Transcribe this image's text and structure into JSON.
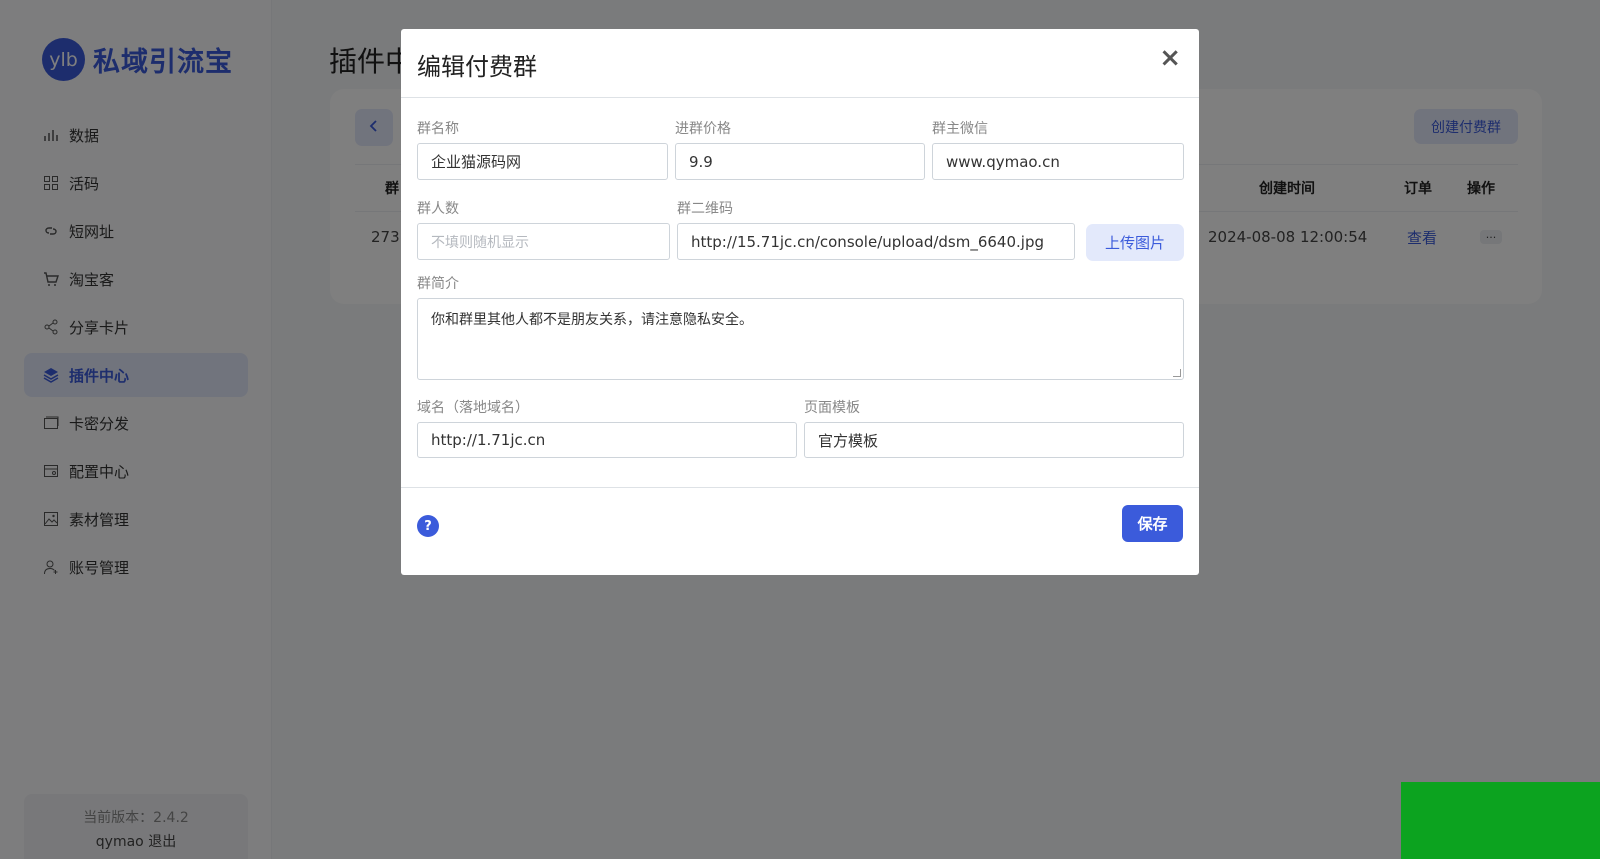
{
  "app": {
    "logo_mark": "ylb",
    "logo_text": "私域引流宝"
  },
  "sidebar": {
    "items": [
      {
        "label": "数据",
        "icon": "bar-chart-icon"
      },
      {
        "label": "活码",
        "icon": "grid-icon"
      },
      {
        "label": "短网址",
        "icon": "link-icon"
      },
      {
        "label": "淘宝客",
        "icon": "cart-icon"
      },
      {
        "label": "分享卡片",
        "icon": "share-icon"
      },
      {
        "label": "插件中心",
        "icon": "layers-icon",
        "active": true
      },
      {
        "label": "卡密分发",
        "icon": "card-icon"
      },
      {
        "label": "配置中心",
        "icon": "settings-icon"
      },
      {
        "label": "素材管理",
        "icon": "image-icon"
      },
      {
        "label": "账号管理",
        "icon": "user-icon"
      }
    ],
    "version": "当前版本：2.4.2",
    "username": "qymao",
    "logout": "退出"
  },
  "main": {
    "page_title": "插件中",
    "create_button": "创建付费群",
    "table": {
      "headers": {
        "col1": "群",
        "created": "创建时间",
        "orders": "订单",
        "actions": "操作"
      },
      "rows": [
        {
          "id": "273",
          "created": "2024-08-08 12:00:54",
          "orders": "查看",
          "more": "···"
        }
      ]
    }
  },
  "modal": {
    "title": "编辑付费群",
    "close": "×",
    "fields": {
      "group_name": {
        "label": "群名称",
        "value": "企业猫源码网"
      },
      "price": {
        "label": "进群价格",
        "value": "9.9"
      },
      "owner_wechat": {
        "label": "群主微信",
        "value": "www.qymao.cn"
      },
      "member_count": {
        "label": "群人数",
        "placeholder": "不填则随机显示"
      },
      "qrcode": {
        "label": "群二维码",
        "value": "http://15.71jc.cn/console/upload/dsm_6640.jpg"
      },
      "intro": {
        "label": "群简介",
        "value": "你和群里其他人都不是朋友关系，请注意隐私安全。"
      },
      "domain": {
        "label": "域名（落地域名）",
        "value": "http://1.71jc.cn"
      },
      "template": {
        "label": "页面模板",
        "value": "官方模板"
      }
    },
    "upload_button": "上传图片",
    "help": "?",
    "save_button": "保存"
  },
  "colors": {
    "accent": "#3b5bdb",
    "accent_light": "#e3e9fb",
    "overlay": "rgba(0,0,0,0.5)",
    "corner_block": "#0ca31f"
  }
}
